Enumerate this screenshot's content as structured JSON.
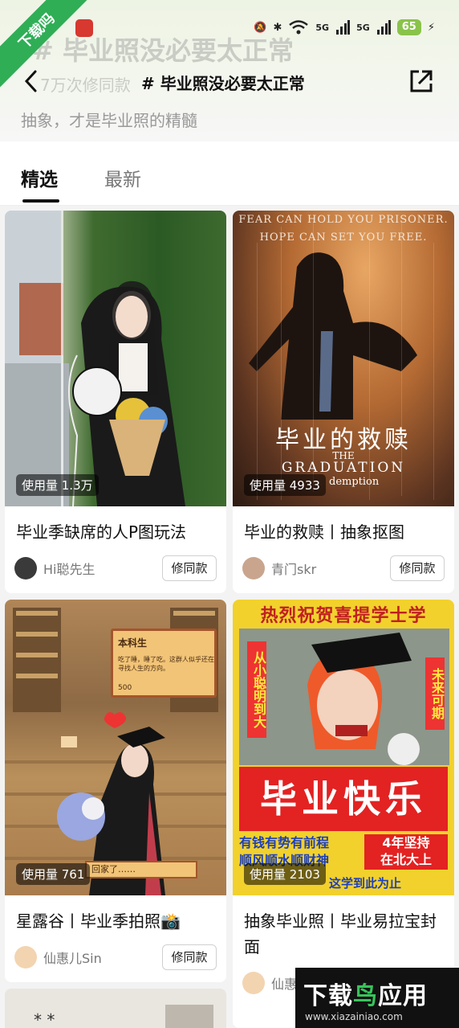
{
  "status_bar": {
    "battery": "65",
    "signal1": "5G",
    "signal2": "5G"
  },
  "watermark": {
    "corner": "下载吗",
    "bottom_main_1": "下载",
    "bottom_main_2": "鸟",
    "bottom_main_3": "应用",
    "bottom_url": "www.xiazainiao.com"
  },
  "header": {
    "bg_title": "# 毕业照没必要太正常",
    "bg_usage": "7万次修同款",
    "nav_title": "#  毕业照没必要太正常",
    "subtitle": "抽象，才是毕业照的精髓"
  },
  "tabs": {
    "featured": "精选",
    "latest": "最新"
  },
  "cards": [
    {
      "usage": "使用量 1.3万",
      "title": "毕业季缺席的人P图玩法",
      "author": "Hi聪先生",
      "button": "修同款"
    },
    {
      "usage": "使用量 4933",
      "title": "毕业的救赎丨抽象抠图",
      "author": "青门skr",
      "button": "修同款",
      "poster_top": "FEAR CAN HOLD YOU PRISONER.",
      "poster_top2": "HOPE CAN SET YOU FREE.",
      "poster_cn": "毕业的救赎",
      "poster_en1": "THE",
      "poster_en2": "GRADUATION",
      "poster_en3": "demption"
    },
    {
      "usage": "使用量 761",
      "title": "星露谷丨毕业季拍照📸",
      "author": "仙惠儿Sin",
      "button": "修同款",
      "box_title": "本科生",
      "box_text": "吃了睡，睡了吃。这群人似乎还在寻找人生的方向。",
      "box_num": "500",
      "bottom_box": "回家了……"
    },
    {
      "usage": "使用量 2103",
      "title": "抽象毕业照丨毕业易拉宝封面",
      "author": "仙惠",
      "button": "修同款",
      "banner_top": "热烈祝贺喜提学士学",
      "left_vert": "从小聪明到大",
      "right_vert": "未来可期",
      "big_red": "毕业快乐",
      "blue1": "有钱有势有前程",
      "blue2": "顺风顺水顺财神",
      "red_box1": "4年坚持",
      "red_box2": "在北大上",
      "bottom_strip": "这学到此为止"
    }
  ],
  "colors": {
    "accent_green": "#2fae56",
    "battery_green": "#8ac34a"
  }
}
